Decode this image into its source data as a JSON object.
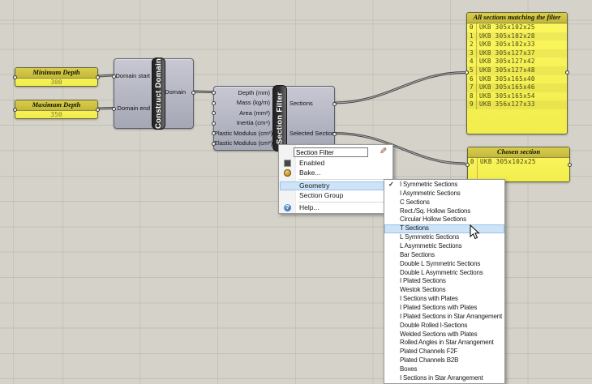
{
  "panels": {
    "min_depth": {
      "title": "Minimum Depth",
      "value": "300"
    },
    "max_depth": {
      "title": "Maximum Depth",
      "value": "350"
    },
    "all_sections": {
      "title": "All sections matching the filter",
      "items": [
        {
          "index": "0",
          "label": "UKB 305x102x25"
        },
        {
          "index": "1",
          "label": "UKB 305x102x28"
        },
        {
          "index": "2",
          "label": "UKB 305x102x33"
        },
        {
          "index": "3",
          "label": "UKB 305x127x37"
        },
        {
          "index": "4",
          "label": "UKB 305x127x42"
        },
        {
          "index": "5",
          "label": "UKB 305x127x48"
        },
        {
          "index": "6",
          "label": "UKB 305x165x40"
        },
        {
          "index": "7",
          "label": "UKB 305x165x46"
        },
        {
          "index": "8",
          "label": "UKB 305x165x54"
        },
        {
          "index": "9",
          "label": "UKB 356x127x33"
        }
      ]
    },
    "chosen_section": {
      "title": "Chosen section",
      "items": [
        {
          "index": "0",
          "label": "UKB 305x102x25"
        }
      ]
    }
  },
  "components": {
    "construct_domain": {
      "label": "Construct Domain",
      "inputs": [
        {
          "label": "Domain start"
        },
        {
          "label": "Domain end"
        }
      ],
      "outputs": [
        {
          "label": "Domain"
        }
      ]
    },
    "section_filter": {
      "label": "Section Filter",
      "inputs": [
        {
          "label": "Depth (mm)"
        },
        {
          "label": "Mass (kg/m)"
        },
        {
          "label": "Area (mm²)"
        },
        {
          "label": "Inertia (cm⁴)"
        },
        {
          "label": "Plastic Modulus (cm³)"
        },
        {
          "label": "Elastic Modulus (cm³)"
        }
      ],
      "outputs": [
        {
          "label": "Sections"
        },
        {
          "label": "Selected Section"
        }
      ]
    }
  },
  "context_menu": {
    "name_value": "Section Filter",
    "enabled_label": "Enabled",
    "bake_label": "Bake...",
    "geometry_label": "Geometry",
    "section_group_label": "Section Group",
    "help_label": "Help..."
  },
  "submenu": {
    "items": [
      {
        "label": "I Symmetric Sections",
        "checked": true
      },
      {
        "label": "I Asymmetric Sections"
      },
      {
        "label": "C Sections"
      },
      {
        "label": "Rect./Sq. Hollow Sections"
      },
      {
        "label": "Circular Hollow Sections"
      },
      {
        "label": "T Sections",
        "highlighted": true
      },
      {
        "label": "L Symmetric Sections"
      },
      {
        "label": "L Asymmetric Sections"
      },
      {
        "label": "Bar Sections"
      },
      {
        "label": "Double L Symmetric Sections"
      },
      {
        "label": "Double L Asymmetric Sections"
      },
      {
        "label": "I Plated Sections"
      },
      {
        "label": "Westok Sections"
      },
      {
        "label": "I Sections with Plates"
      },
      {
        "label": "I Plated Sections with Plates"
      },
      {
        "label": "I Plated Sections in Star Arrangement"
      },
      {
        "label": "Double Rolled I-Sections"
      },
      {
        "label": "Welded Sections with Plates"
      },
      {
        "label": "Rolled Angles in Star Arrangement"
      },
      {
        "label": "Plated Channels F2F"
      },
      {
        "label": "Plated Channels B2B"
      },
      {
        "label": "Boxes"
      },
      {
        "label": "I Sections in Star Arrangement"
      }
    ]
  },
  "icons": {
    "edit_glyph": "✎",
    "submenu_arrow": "▸",
    "checkmark": "✓",
    "help_glyph": "?"
  },
  "colors": {
    "canvas": "#d5d2ca",
    "panel_yellow": "#faf556",
    "panel_title": "#cfc342",
    "component_gray": "#b4b5c2",
    "capsule_dark": "#2e2e2e",
    "menu_highlight": "#cde3f8",
    "wire": "#474747"
  }
}
